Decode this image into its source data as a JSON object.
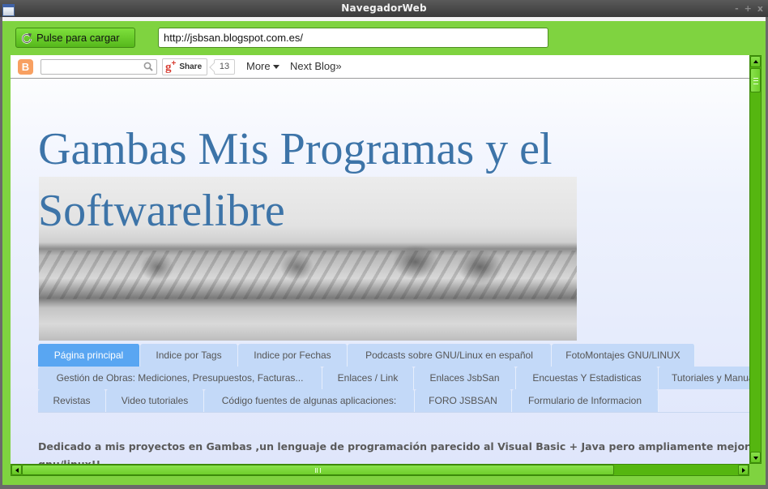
{
  "window": {
    "title": "NavegadorWeb",
    "controls": {
      "minimize": "-",
      "maximize": "+",
      "close": "x"
    }
  },
  "toolbar": {
    "load_button_label": "Pulse para cargar",
    "url_value": "http://jsbsan.blogspot.com.es/"
  },
  "blogger_navbar": {
    "logo_letter": "B",
    "search_placeholder": "",
    "share_label": "Share",
    "gplus_label": "g+",
    "share_count": "13",
    "more_label": "More",
    "next_blog_label": "Next Blog»"
  },
  "blog": {
    "title": "Gambas Mis Programas y el Softwarelibre",
    "tabs_row1": [
      {
        "label": "Página principal",
        "active": true
      },
      {
        "label": "Indice por Tags"
      },
      {
        "label": "Indice por Fechas"
      },
      {
        "label": "Podcasts sobre GNU/Linux en español"
      },
      {
        "label": "FotoMontajes GNU/LINUX"
      }
    ],
    "tabs_row2": [
      {
        "label": "Gestión de Obras: Mediciones, Presupuestos, Facturas..."
      },
      {
        "label": "Enlaces / Link"
      },
      {
        "label": "Enlaces JsbSan"
      },
      {
        "label": "Encuestas Y Estadisticas"
      },
      {
        "label": "Tutoriales y Manuales"
      }
    ],
    "tabs_row3": [
      {
        "label": "Revistas"
      },
      {
        "label": "Video tutoriales"
      },
      {
        "label": "Código fuentes de algunas aplicaciones:"
      },
      {
        "label": "FORO JSBSAN"
      },
      {
        "label": "Formulario de Informacion"
      }
    ],
    "description": "Dedicado a mis proyectos en Gambas ,un lenguaje de programación parecido al Visual Basic + Java pero ampliamente mejorado y gnu/linux!!"
  },
  "colors": {
    "accent_green": "#7fd340",
    "title_blue": "#3d74a8",
    "active_tab": "#59a6f2",
    "tab_bg": "#c3d9f8"
  }
}
